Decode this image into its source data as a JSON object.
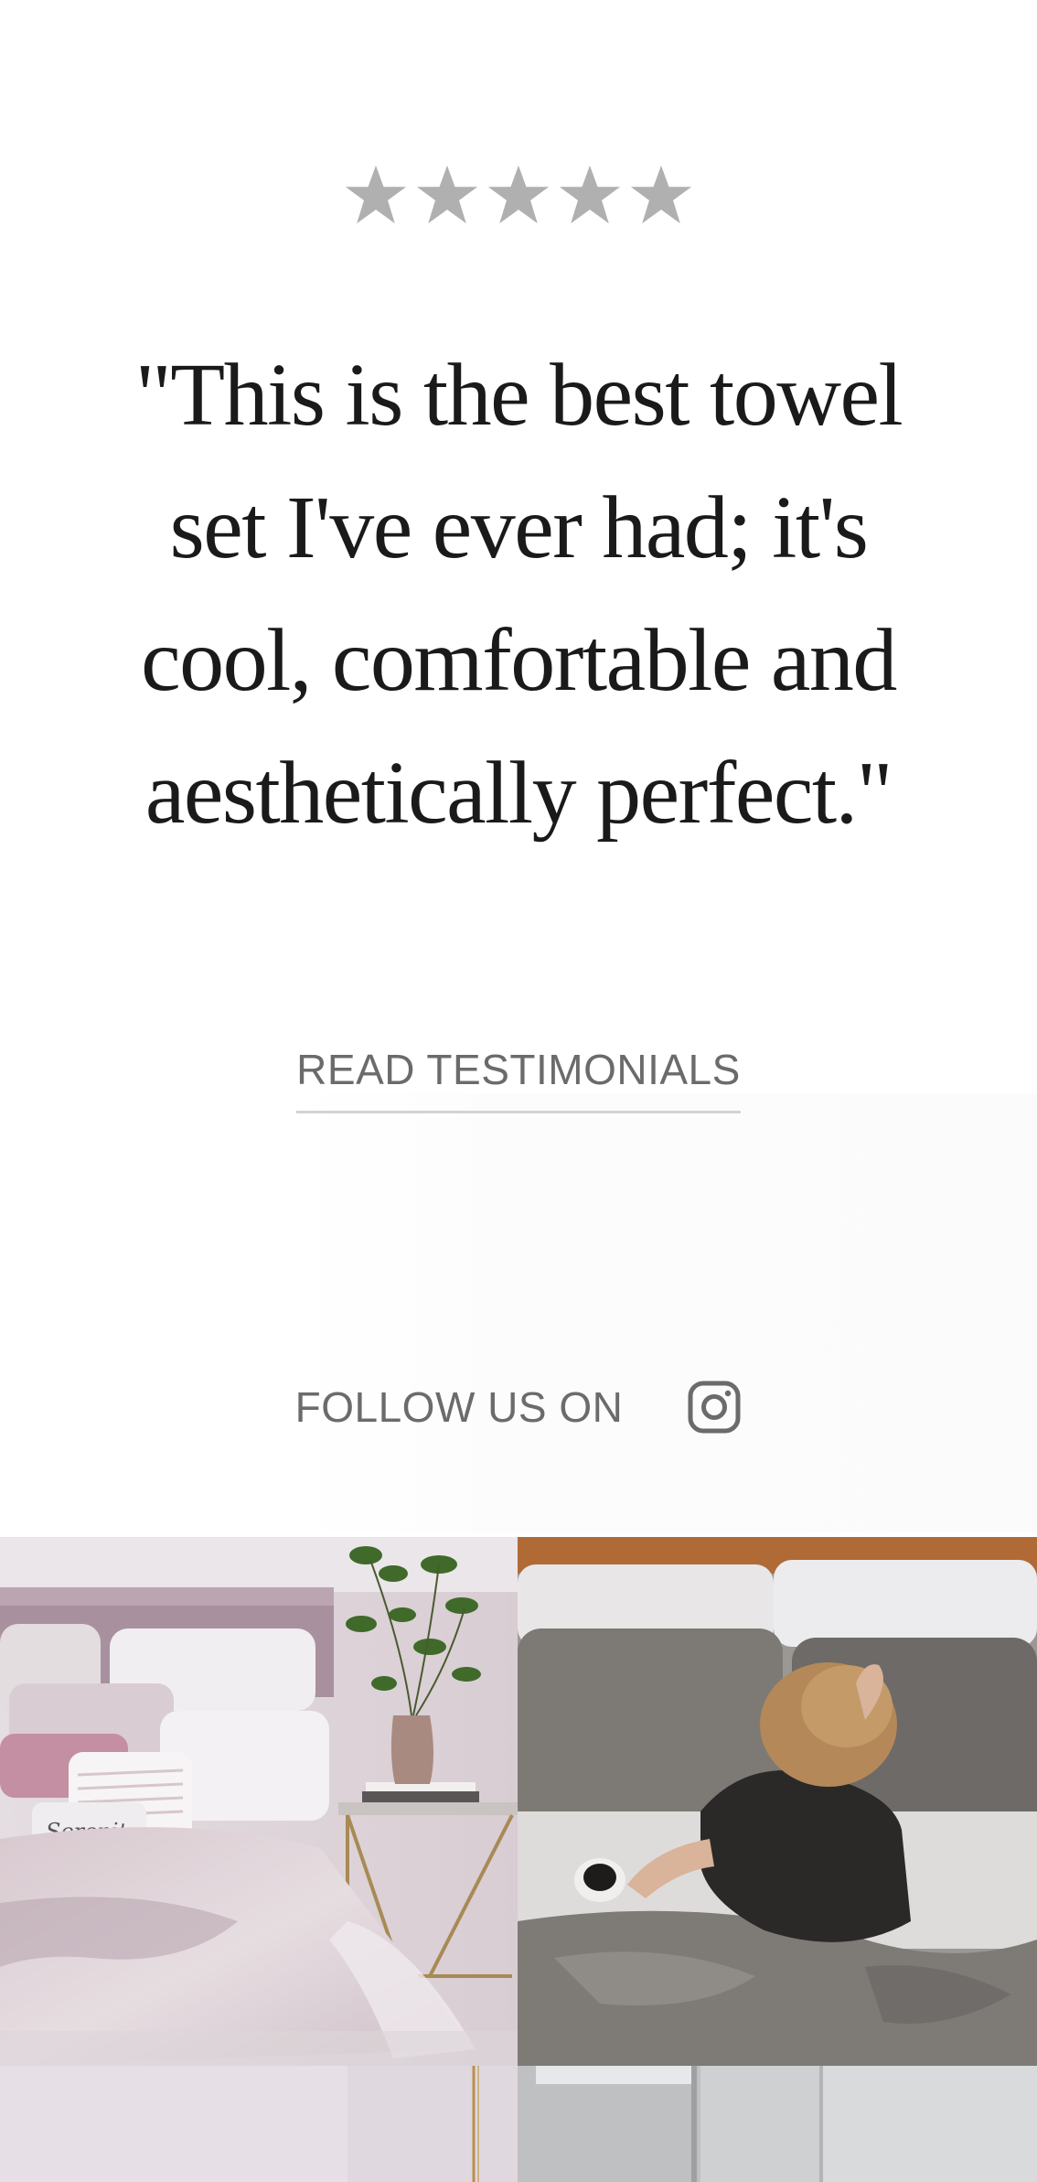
{
  "rating": {
    "stars": 5,
    "star_color": "#b0b0b0"
  },
  "testimonial": {
    "quote": "\"This is the best towel set I've ever had; it's cool, comfortable and aesthetically perfect.\""
  },
  "links": {
    "read_testimonials": "READ TESTIMONIALS"
  },
  "social": {
    "follow_label": "FOLLOW US ON",
    "icon": "instagram-icon"
  },
  "gallery": {
    "tiles": [
      {
        "subject": "bedroom with lilac bedding and plant"
      },
      {
        "subject": "woman lying in bed with coffee cup"
      },
      {
        "subject": "lilac wall with gold hanging"
      },
      {
        "subject": "grey window interior"
      }
    ],
    "pillow_script": "Serenity"
  },
  "colors": {
    "text_primary": "#1a1a1a",
    "text_muted": "#6b6b6b",
    "underline": "#d3d3d3"
  }
}
